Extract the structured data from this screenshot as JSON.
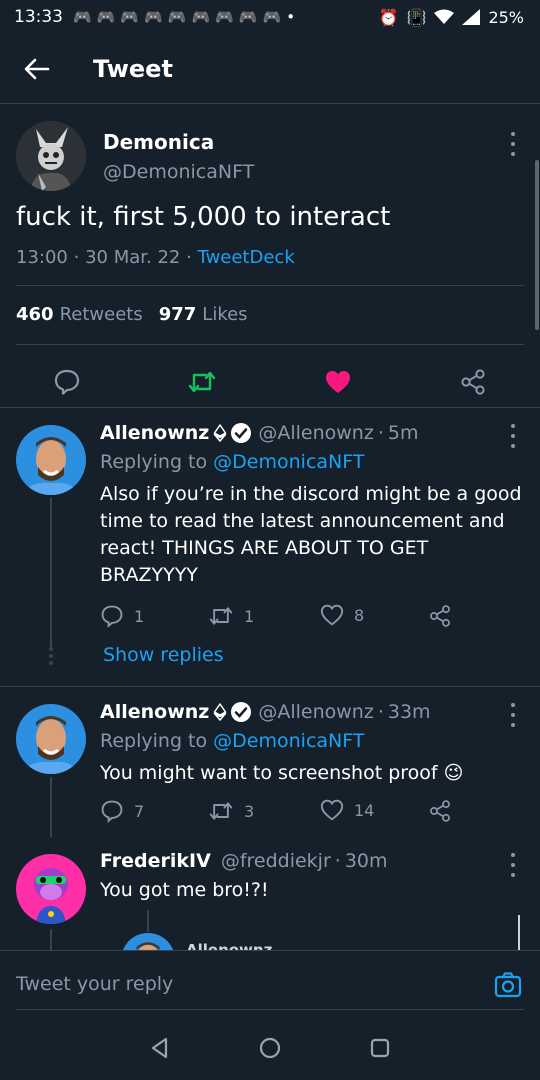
{
  "status_bar": {
    "time": "13:33",
    "battery": "25%"
  },
  "header": {
    "title": "Tweet"
  },
  "main_tweet": {
    "name": "Demonica",
    "handle": "@DemonicaNFT",
    "text": "fuck it, first 5,000 to interact",
    "time": "13:00",
    "date": "30 Mar. 22",
    "source": "TweetDeck",
    "retweets_count": "460",
    "retweets_label": "Retweets",
    "likes_count": "977",
    "likes_label": "Likes",
    "liked": true
  },
  "replies": [
    {
      "name": "Allenownz",
      "handle": "@Allenownz",
      "age": "5m",
      "replying_prefix": "Replying to",
      "replying_to": "@DemonicaNFT",
      "text": "Also if you’re in the discord might be a good time to read the latest announcement and react! THINGS ARE ABOUT TO GET BRAZYYYY",
      "reply_count": "1",
      "retweet_count": "1",
      "like_count": "8",
      "show_replies": "Show replies"
    },
    {
      "name": "Allenownz",
      "handle": "@Allenownz",
      "age": "33m",
      "replying_prefix": "Replying to",
      "replying_to": "@DemonicaNFT",
      "text": "You might want to screenshot proof 😉",
      "reply_count": "7",
      "retweet_count": "3",
      "like_count": "14"
    },
    {
      "name": "FrederikIV",
      "handle": "@freddiekjr",
      "age": "30m",
      "text": "You got me bro!?!"
    }
  ],
  "nested_preview": {
    "name": "Allenownz"
  },
  "reply_bar": {
    "placeholder": "Tweet your reply"
  },
  "colors": {
    "background": "#15202b",
    "accent": "#1da1f2",
    "like": "#f91880",
    "retweet": "#17bf63",
    "muted": "#8899a6"
  }
}
